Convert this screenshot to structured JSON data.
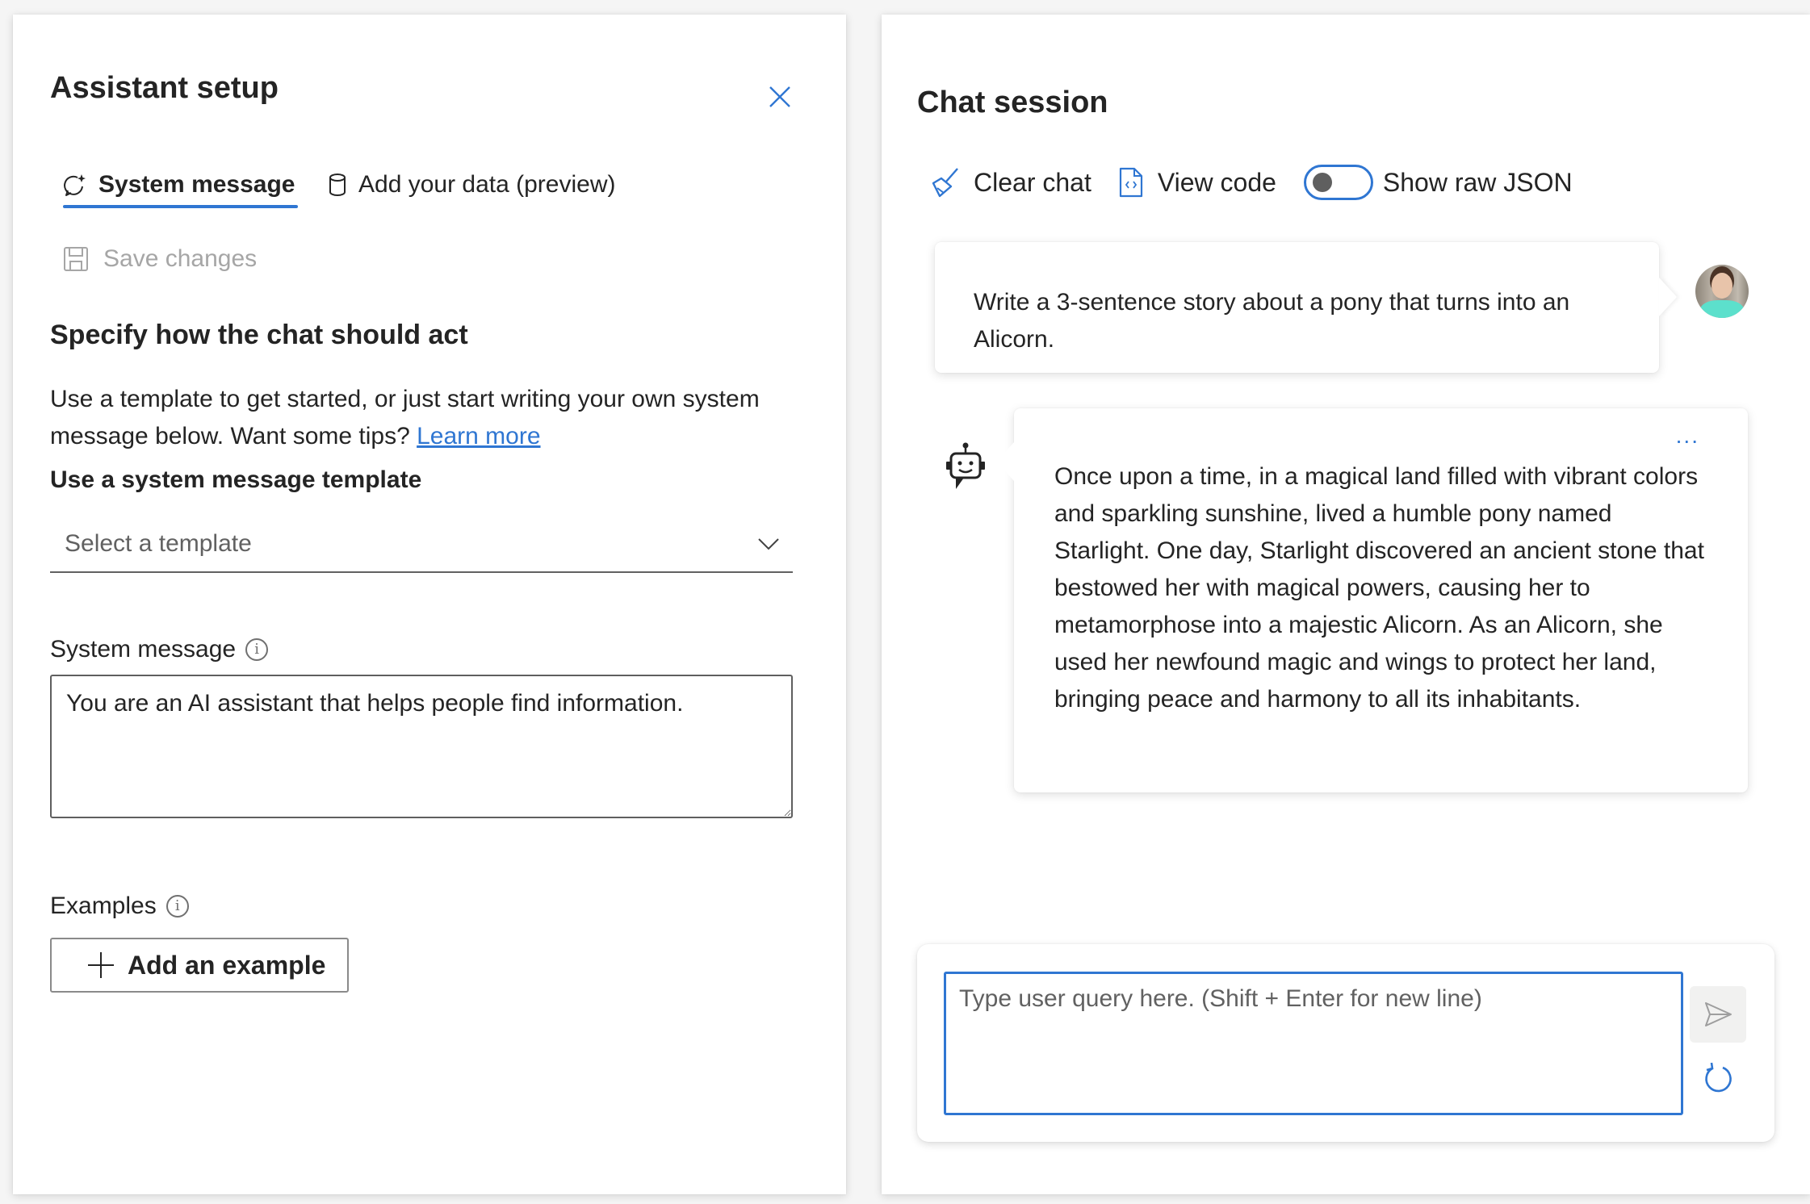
{
  "assistant_setup": {
    "title": "Assistant setup",
    "close_icon": "close-icon",
    "tabs": [
      {
        "label": "System message",
        "icon": "chat-sparkle-icon",
        "active": true
      },
      {
        "label": "Add your data (preview)",
        "icon": "database-icon",
        "active": false
      }
    ],
    "save_changes": {
      "label": "Save changes",
      "icon": "save-icon",
      "enabled": false
    },
    "section": {
      "heading": "Specify how the chat should act",
      "description": "Use a template to get started, or just start writing your own system message below. Want some tips? ",
      "learn_more": "Learn more"
    },
    "template": {
      "label": "Use a system message template",
      "placeholder": "Select a template"
    },
    "system_message": {
      "label": "System message",
      "value": "You are an AI assistant that helps people find information."
    },
    "examples": {
      "label": "Examples",
      "add_button": "Add an example"
    }
  },
  "chat_session": {
    "title": "Chat session",
    "toolbar": {
      "clear_chat": "Clear chat",
      "view_code": "View code",
      "show_raw_json": "Show raw JSON",
      "show_raw_json_on": false
    },
    "messages": [
      {
        "role": "user",
        "text": "Write a 3-sentence story about a pony that turns into an Alicorn."
      },
      {
        "role": "assistant",
        "text": "Once upon a time, in a magical land filled with vibrant colors and sparkling sunshine, lived a humble pony named Starlight. One day, Starlight discovered an ancient stone that bestowed her with magical powers, causing her to metamorphose into a majestic Alicorn. As an Alicorn, she used her newfound magic and wings to protect her land, bringing peace and harmony to all its inhabitants.",
        "more_options": "..."
      }
    ],
    "input": {
      "placeholder": "Type user query here. (Shift + Enter for new line)",
      "value": ""
    }
  },
  "colors": {
    "accent": "#2f76d2",
    "text": "#242424",
    "disabled": "#a6a6a6"
  }
}
